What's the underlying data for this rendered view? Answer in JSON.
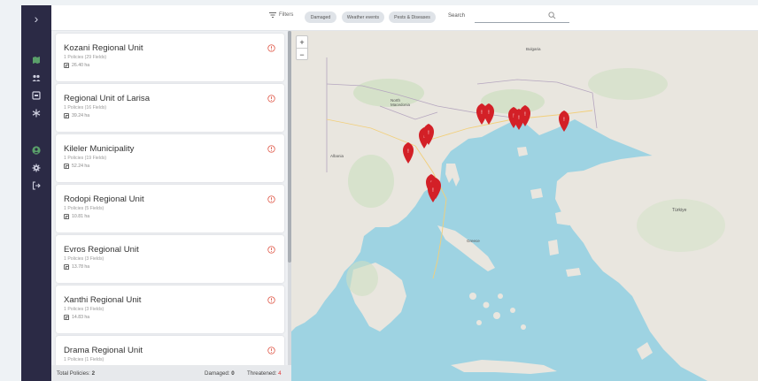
{
  "topbar": {
    "filters_label": "Filters",
    "chips": [
      "Damaged",
      "Weather events",
      "Pests & Diseases"
    ],
    "search_label": "Search",
    "search_value": ""
  },
  "sidebar": {
    "expand_glyph": "›",
    "icons": [
      "map-icon",
      "users-icon",
      "inbox-icon",
      "snowflake-icon",
      "avatar-icon",
      "gear-icon",
      "logout-icon"
    ]
  },
  "regions": [
    {
      "title": "Kozani Regional Unit",
      "policies": "1 Policies (29 Fields)",
      "area": "26.40 ha"
    },
    {
      "title": "Regional Unit of Larisa",
      "policies": "1 Policies (16 Fields)",
      "area": "39.24 ha"
    },
    {
      "title": "Kileler Municipality",
      "policies": "1 Policies (19 Fields)",
      "area": "52.24 ha"
    },
    {
      "title": "Rodopi Regional Unit",
      "policies": "1 Policies (5 Fields)",
      "area": "10.81 ha"
    },
    {
      "title": "Evros Regional Unit",
      "policies": "1 Policies (3 Fields)",
      "area": "13.78 ha"
    },
    {
      "title": "Xanthi Regional Unit",
      "policies": "1 Policies (3 Fields)",
      "area": "14.83 ha"
    },
    {
      "title": "Drama Regional Unit",
      "policies": "1 Policies (1 Fields)",
      "area": ""
    }
  ],
  "footer": {
    "total_label": "Total Policies:",
    "total_value": "2",
    "damaged_label": "Damaged:",
    "damaged_value": "0",
    "threatened_label": "Threatened:",
    "threatened_value": "4"
  },
  "map": {
    "zoom_in": "+",
    "zoom_out": "−",
    "labels": [
      "Bulgaria",
      "Albania",
      "North Macedonia",
      "Greece",
      "Türkiye"
    ]
  },
  "colors": {
    "sidebar": "#2b2a45",
    "sidebar_active": "#5aa06a",
    "marker": "#d32027",
    "warning": "#e05a4a",
    "sea": "#9ed3e2",
    "land": "#e9e6df"
  }
}
